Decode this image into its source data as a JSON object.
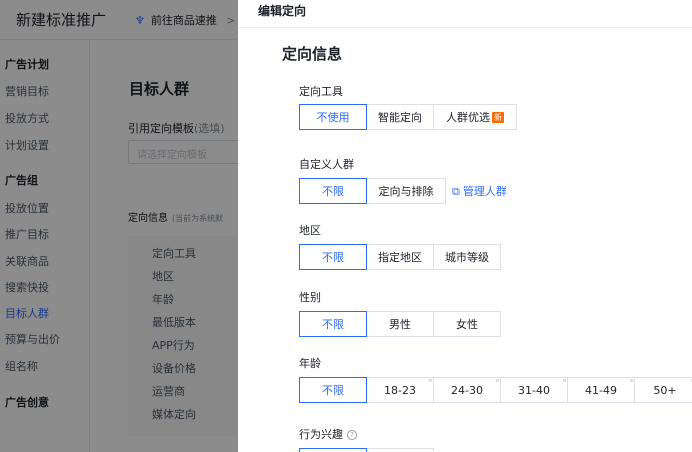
{
  "background": {
    "title": "新建标准推广",
    "goto_link": "前往商品速推",
    "goto_suffix": ">",
    "sidebar": {
      "group1": "广告计划",
      "group1_items": [
        "营销目标",
        "投放方式",
        "计划设置"
      ],
      "group2": "广告组",
      "group2_items": [
        "投放位置",
        "推广目标",
        "关联商品",
        "搜索快投",
        "目标人群",
        "预算与出价",
        "组名称"
      ],
      "group3": "广告创意"
    },
    "main": {
      "heading": "目标人群",
      "template_label": "引用定向模板",
      "template_label_sub": "(选填)",
      "template_placeholder": "请选择定向模板",
      "info_label": "定向信息",
      "info_hint": "(当前为系统默",
      "list_items": [
        "定向工具",
        "地区",
        "年龄",
        "最低版本",
        "APP行为",
        "设备价格",
        "运营商",
        "媒体定向"
      ]
    }
  },
  "drawer": {
    "title": "编辑定向",
    "section_title": "定向信息",
    "tools": {
      "label": "定向工具",
      "options": [
        "不使用",
        "智能定向",
        "人群优选"
      ],
      "new_badge": "新"
    },
    "custom_audience": {
      "label": "自定义人群",
      "options": [
        "不限",
        "定向与排除"
      ],
      "manage_link": "管理人群"
    },
    "region": {
      "label": "地区",
      "options": [
        "不限",
        "指定地区",
        "城市等级"
      ]
    },
    "gender": {
      "label": "性别",
      "options": [
        "不限",
        "男性",
        "女性"
      ]
    },
    "age": {
      "label": "年龄",
      "options": [
        "不限",
        "18-23",
        "24-30",
        "31-40",
        "41-49",
        "50+"
      ]
    },
    "interest": {
      "label": "行为兴趣"
    }
  },
  "colors": {
    "accent": "#2f6bff",
    "badge": "#ff6a00",
    "overlay": "rgba(0,0,0,0.45)"
  }
}
